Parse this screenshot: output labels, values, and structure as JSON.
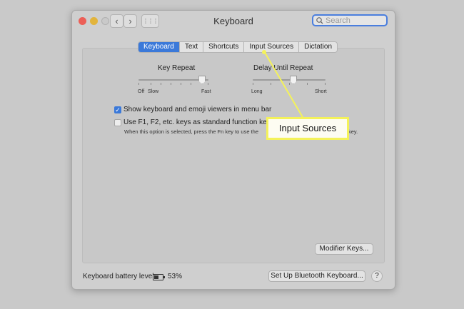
{
  "window": {
    "title": "Keyboard"
  },
  "toolbar": {
    "back": "‹",
    "forward": "›",
    "grid": "⋮⋮⋮",
    "search_placeholder": "Search"
  },
  "tabs": [
    "Keyboard",
    "Text",
    "Shortcuts",
    "Input Sources",
    "Dictation"
  ],
  "selected_tab": "Keyboard",
  "key_repeat": {
    "label": "Key Repeat",
    "left": "Off",
    "left2": "Slow",
    "right": "Fast",
    "level": 0.9
  },
  "delay_until_repeat": {
    "label": "Delay Until Repeat",
    "left": "Long",
    "right": "Short",
    "level": 0.55
  },
  "options": {
    "show_viewers": {
      "label": "Show keyboard and emoji viewers in menu bar",
      "checked": true
    },
    "fn_keys": {
      "label": "Use F1, F2, etc. keys as standard function keys",
      "checked": false,
      "note": "When this option is selected, press the Fn key to use the"
    },
    "note_tail": "key."
  },
  "buttons": {
    "modifier": "Modifier Keys...",
    "bluetooth": "Set Up Bluetooth Keyboard...",
    "help": "?"
  },
  "battery": {
    "label": "Keyboard battery level:",
    "percent_text": "53%",
    "level": 0.53
  },
  "callout": {
    "text": "Input Sources",
    "color": "#f4f25a"
  },
  "colors": {
    "accent": "#3b79d9",
    "close": "#ec5f57",
    "minimize": "#e2b43c",
    "zoom": "#c9c9c9"
  }
}
